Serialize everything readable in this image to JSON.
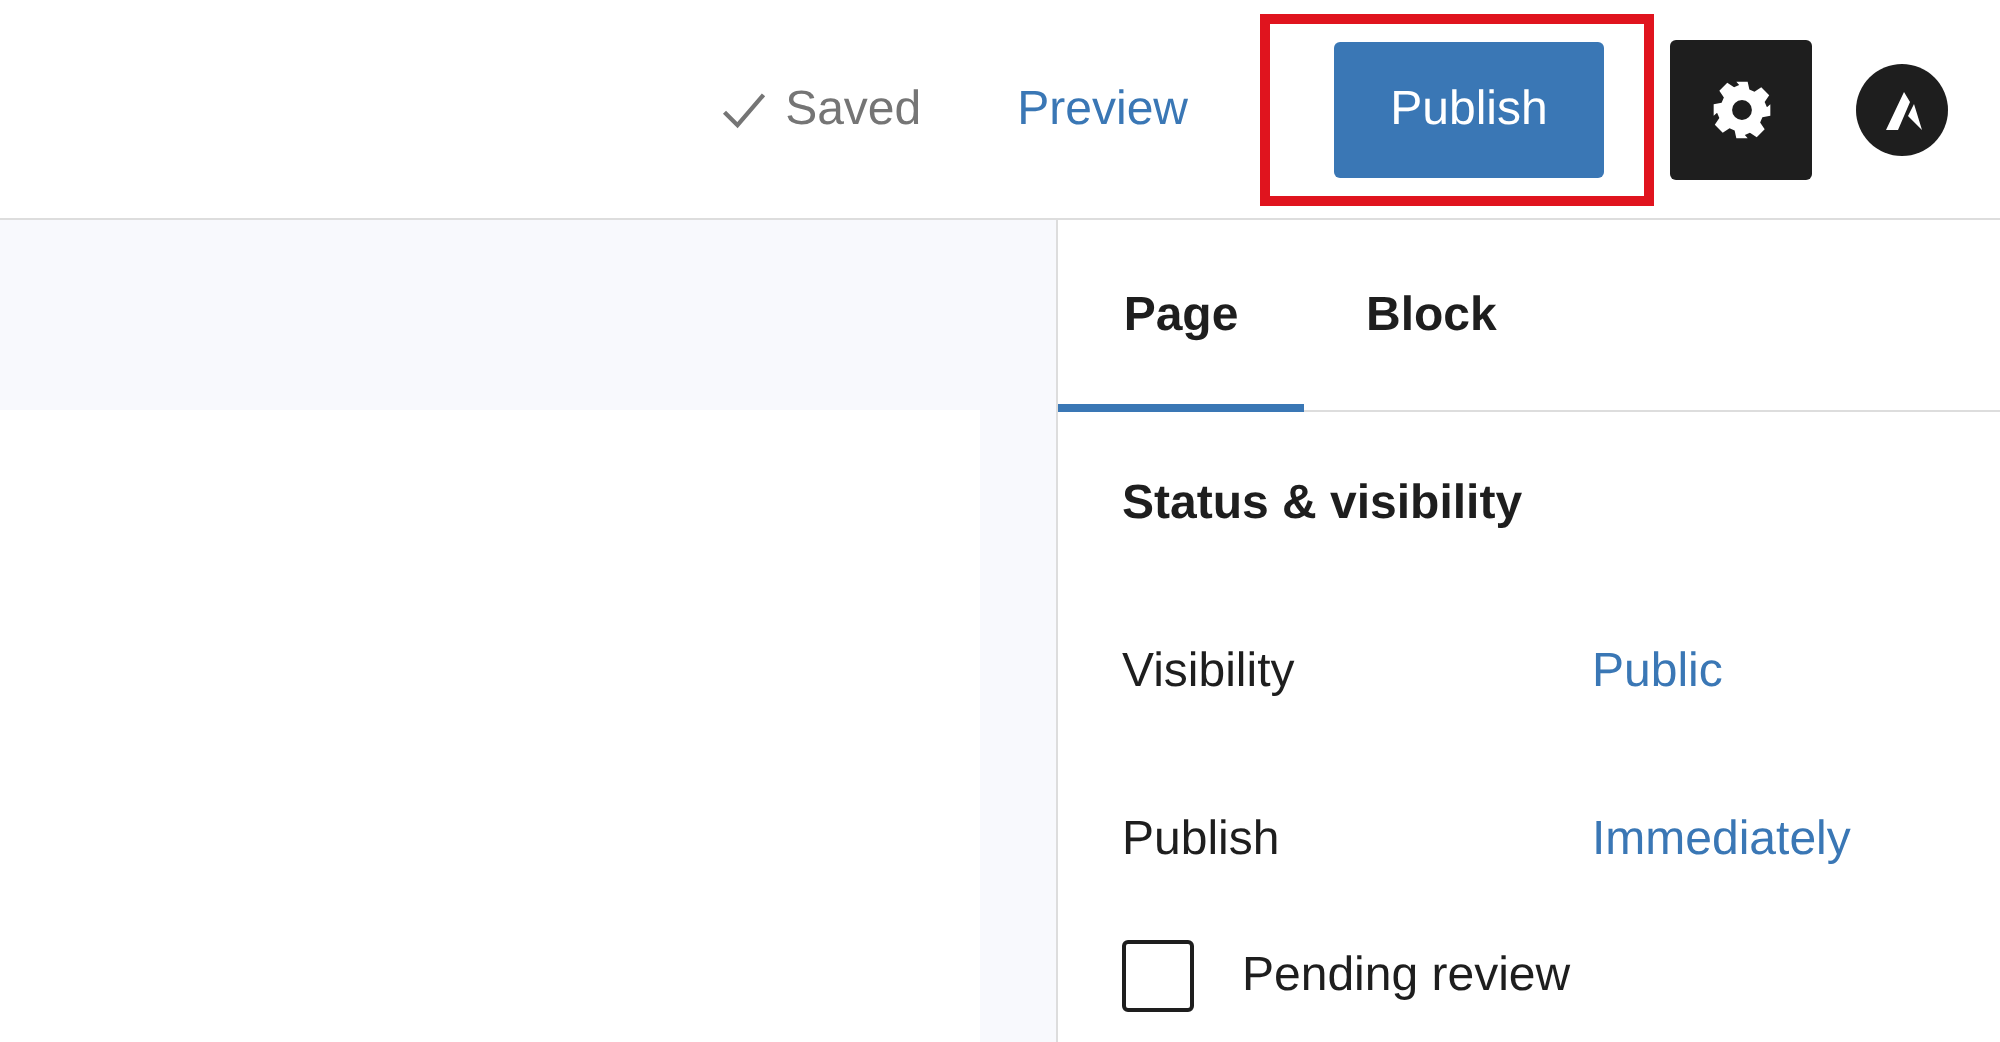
{
  "header": {
    "save_status": "Saved",
    "preview": "Preview",
    "publish": "Publish",
    "publish_highlighted": true,
    "settings_active": true
  },
  "sidebar": {
    "tabs": [
      {
        "label": "Page",
        "selected": true
      },
      {
        "label": "Block",
        "selected": false
      }
    ],
    "section_title": "Status & visibility",
    "rows": [
      {
        "label": "Visibility",
        "value": "Public"
      },
      {
        "label": "Publish",
        "value": "Immediately"
      }
    ],
    "pending_review": {
      "label": "Pending review",
      "checked": false
    }
  }
}
